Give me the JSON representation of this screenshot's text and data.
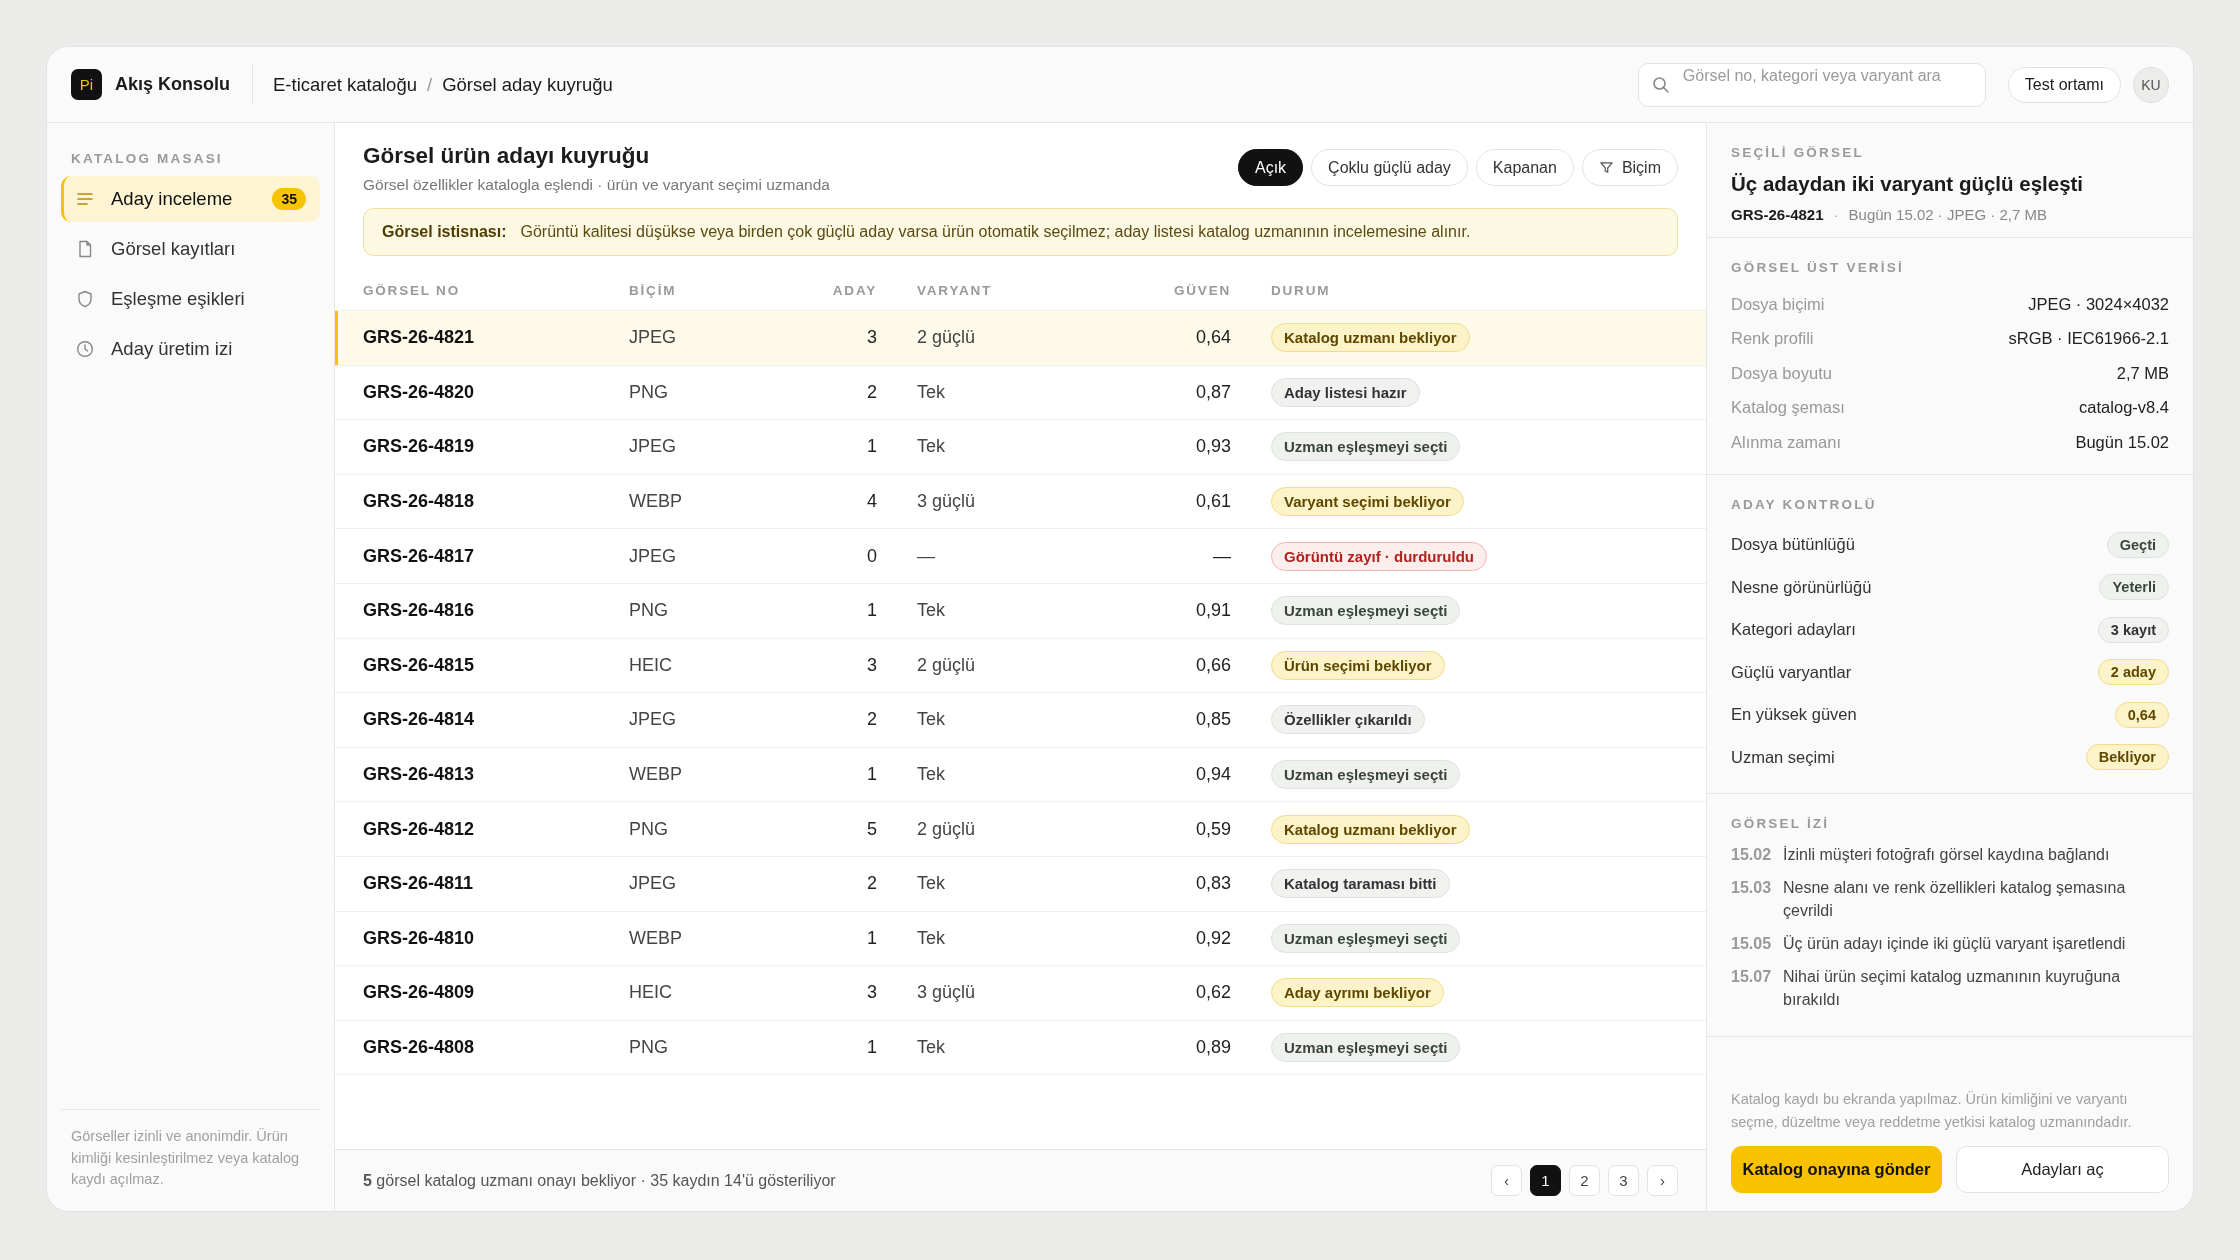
{
  "app": {
    "logo": "Pi",
    "name": "Akış Konsolu"
  },
  "breadcrumb": {
    "items": [
      "E-ticaret kataloğu",
      "Görsel aday kuyruğu"
    ],
    "separator": "/"
  },
  "search": {
    "placeholder": "Görsel no, kategori veya varyant ara"
  },
  "environment": "Test ortamı",
  "user": {
    "initials": "KU"
  },
  "sidebar": {
    "heading": "KATALOG MASASI",
    "items": [
      {
        "label": "Aday inceleme",
        "badge": "35",
        "selected": true
      },
      {
        "label": "Görsel kayıtları",
        "selected": false
      },
      {
        "label": "Eşleşme eşikleri",
        "selected": false
      },
      {
        "label": "Aday üretim izi",
        "selected": false
      }
    ],
    "note": "Görseller izinli ve anonimdir. Ürün kimliği kesinleştirilmez veya katalog kaydı açılmaz."
  },
  "main": {
    "title": "Görsel ürün adayı kuyruğu",
    "subtitle": "Görsel özellikler katalogla eşlendi · ürün ve varyant seçimi uzmanda",
    "filters": [
      {
        "label": "Açık",
        "kind": "chip",
        "selected": true
      },
      {
        "label": "Çoklu güçlü aday",
        "kind": "chip",
        "selected": false
      },
      {
        "label": "Kapanan",
        "kind": "chip",
        "selected": false
      },
      {
        "label": "Biçim",
        "kind": "filter",
        "selected": false
      }
    ],
    "alert": {
      "label": "Görsel istisnası:",
      "text": "Görüntü kalitesi düşükse veya birden çok güçlü aday varsa ürün otomatik seçilmez; aday listesi katalog uzmanının incelemesine alınır."
    },
    "table": {
      "columns": [
        "GÖRSEL NO",
        "BİÇİM",
        "ADAY",
        "VARYANT",
        "GÜVEN",
        "DURUM"
      ],
      "rows": [
        {
          "id": "GRS-26-4821",
          "format": "JPEG",
          "candidates": "3",
          "variant": "2 güçlü",
          "confidence": "0,64",
          "status": "Katalog uzmanı bekliyor",
          "color": "#fdf3c8",
          "selected": true
        },
        {
          "id": "GRS-26-4820",
          "format": "PNG",
          "candidates": "2",
          "variant": "Tek",
          "confidence": "0,87",
          "status": "Aday listesi hazır",
          "color": "#f1f1f0",
          "selected": false
        },
        {
          "id": "GRS-26-4819",
          "format": "JPEG",
          "candidates": "1",
          "variant": "Tek",
          "confidence": "0,93",
          "status": "Uzman eşleşmeyi seçti",
          "color": "#eef1ee",
          "selected": false
        },
        {
          "id": "GRS-26-4818",
          "format": "WEBP",
          "candidates": "4",
          "variant": "3 güçlü",
          "confidence": "0,61",
          "status": "Varyant seçimi bekliyor",
          "color": "#fdf3c8",
          "selected": false
        },
        {
          "id": "GRS-26-4817",
          "format": "JPEG",
          "candidates": "0",
          "variant": "—",
          "confidence": "—",
          "status": "Görüntü zayıf · durduruldu",
          "color": "#fdeeee",
          "selected": false
        },
        {
          "id": "GRS-26-4816",
          "format": "PNG",
          "candidates": "1",
          "variant": "Tek",
          "confidence": "0,91",
          "status": "Uzman eşleşmeyi seçti",
          "color": "#eef1ee",
          "selected": false
        },
        {
          "id": "GRS-26-4815",
          "format": "HEIC",
          "candidates": "3",
          "variant": "2 güçlü",
          "confidence": "0,66",
          "status": "Ürün seçimi bekliyor",
          "color": "#fdf3c8",
          "selected": false
        },
        {
          "id": "GRS-26-4814",
          "format": "JPEG",
          "candidates": "2",
          "variant": "Tek",
          "confidence": "0,85",
          "status": "Özellikler çıkarıldı",
          "color": "#f1f1f0",
          "selected": false
        },
        {
          "id": "GRS-26-4813",
          "format": "WEBP",
          "candidates": "1",
          "variant": "Tek",
          "confidence": "0,94",
          "status": "Uzman eşleşmeyi seçti",
          "color": "#eef1ee",
          "selected": false
        },
        {
          "id": "GRS-26-4812",
          "format": "PNG",
          "candidates": "5",
          "variant": "2 güçlü",
          "confidence": "0,59",
          "status": "Katalog uzmanı bekliyor",
          "color": "#fdf3c8",
          "selected": false
        },
        {
          "id": "GRS-26-4811",
          "format": "JPEG",
          "candidates": "2",
          "variant": "Tek",
          "confidence": "0,83",
          "status": "Katalog taraması bitti",
          "color": "#f1f1f0",
          "selected": false
        },
        {
          "id": "GRS-26-4810",
          "format": "WEBP",
          "candidates": "1",
          "variant": "Tek",
          "confidence": "0,92",
          "status": "Uzman eşleşmeyi seçti",
          "color": "#eef1ee",
          "selected": false
        },
        {
          "id": "GRS-26-4809",
          "format": "HEIC",
          "candidates": "3",
          "variant": "3 güçlü",
          "confidence": "0,62",
          "status": "Aday ayrımı bekliyor",
          "color": "#fdf3c8",
          "selected": false
        },
        {
          "id": "GRS-26-4808",
          "format": "PNG",
          "candidates": "1",
          "variant": "Tek",
          "confidence": "0,89",
          "status": "Uzman eşleşmeyi seçti",
          "color": "#eef1ee",
          "selected": false
        }
      ]
    },
    "footer": {
      "summary": "**5** görsel katalog uzmanı onayı bekliyor · 35 kaydın 14'ü gösteriliyor",
      "prev": "‹",
      "next": "›",
      "pages": [
        {
          "label": "1",
          "selected": true
        },
        {
          "label": "2",
          "selected": false
        },
        {
          "label": "3",
          "selected": false
        }
      ]
    }
  },
  "detail": {
    "heading": "SEÇİLİ GÖRSEL",
    "title": "Üç adaydan iki varyant güçlü eşleşti",
    "id": "GRS-26-4821",
    "separator": "·",
    "meta": "Bugün 15.02 · JPEG · 2,7 MB",
    "metadata": {
      "heading": "GÖRSEL ÜST VERİSİ",
      "rows": [
        {
          "label": "Dosya biçimi",
          "value": "JPEG · 3024×4032"
        },
        {
          "label": "Renk profili",
          "value": "sRGB · IEC61966-2.1"
        },
        {
          "label": "Dosya boyutu",
          "value": "2,7 MB"
        },
        {
          "label": "Katalog şeması",
          "value": "catalog-v8.4"
        },
        {
          "label": "Alınma zamanı",
          "value": "Bugün 15.02"
        }
      ]
    },
    "checks": {
      "heading": "ADAY KONTROLÜ",
      "rows": [
        {
          "label": "Dosya bütünlüğü",
          "value": "Geçti",
          "color": "#eef1ee"
        },
        {
          "label": "Nesne görünürlüğü",
          "value": "Yeterli",
          "color": "#eef1ee"
        },
        {
          "label": "Kategori adayları",
          "value": "3 kayıt",
          "color": "#f1f1f0"
        },
        {
          "label": "Güçlü varyantlar",
          "value": "2 aday",
          "color": "#fdf3c8"
        },
        {
          "label": "En yüksek güven",
          "value": "0,64",
          "color": "#fdf3c8"
        },
        {
          "label": "Uzman seçimi",
          "value": "Bekliyor",
          "color": "#fdf3c8"
        }
      ]
    },
    "trail": {
      "heading": "GÖRSEL İZİ",
      "entries": [
        {
          "time": "15.02",
          "text": "İzinli müşteri fotoğrafı görsel kaydına bağlandı"
        },
        {
          "time": "15.03",
          "text": "Nesne alanı ve renk özellikleri katalog şemasına çevrildi"
        },
        {
          "time": "15.05",
          "text": "Üç ürün adayı içinde iki güçlü varyant işaretlendi"
        },
        {
          "time": "15.07",
          "text": "Nihai ürün seçimi katalog uzmanının kuyruğuna bırakıldı"
        }
      ]
    },
    "note": "Katalog kaydı bu ekranda yapılmaz. Ürün kimliğini ve varyantı seçme, düzeltme veya reddetme yetkisi katalog uzmanındadır.",
    "actions": [
      {
        "label": "Katalog onayına gönder",
        "kind": "primary"
      },
      {
        "label": "Adayları aç",
        "kind": "secondary"
      }
    ]
  }
}
